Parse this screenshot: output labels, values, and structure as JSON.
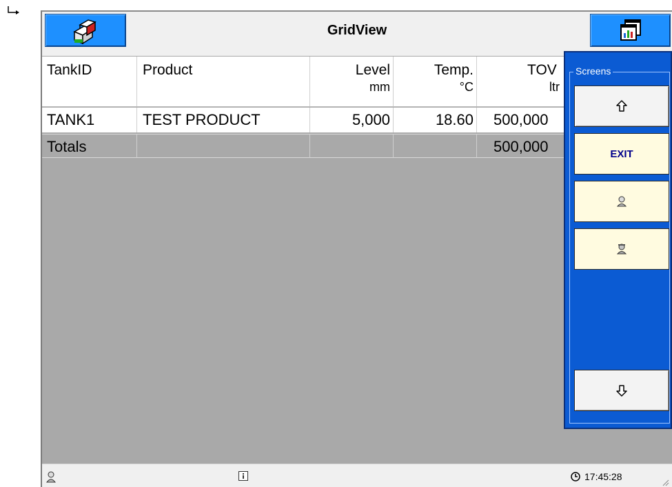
{
  "window": {
    "title": "GridView"
  },
  "toolbar": {
    "left_icon": "tanks-icon",
    "right_icon": "chart-window-icon"
  },
  "grid": {
    "columns": [
      {
        "line1": "TankID",
        "line2": ""
      },
      {
        "line1": "Product",
        "line2": ""
      },
      {
        "line1": "Level",
        "line2": "mm"
      },
      {
        "line1": "Temp.",
        "line2": "°C"
      },
      {
        "line1": "TOV",
        "line2": "ltr"
      }
    ],
    "rows": [
      [
        "TANK1",
        "TEST PRODUCT",
        "5,000",
        "18.60",
        "500,000"
      ]
    ],
    "totals": [
      "Totals",
      "",
      "",
      "",
      "500,000"
    ]
  },
  "screens_panel": {
    "label": "Screens",
    "buttons": [
      {
        "icon": "up-arrow-icon"
      },
      {
        "label": "EXIT"
      },
      {
        "icon": "user-icon"
      },
      {
        "icon": "user-group-icon"
      },
      {
        "icon": "down-arrow-icon"
      }
    ]
  },
  "status_bar": {
    "time": "17:45:28",
    "icons": [
      "user-icon",
      "info-icon",
      "clock-icon",
      "resize-grip-icon"
    ]
  }
}
